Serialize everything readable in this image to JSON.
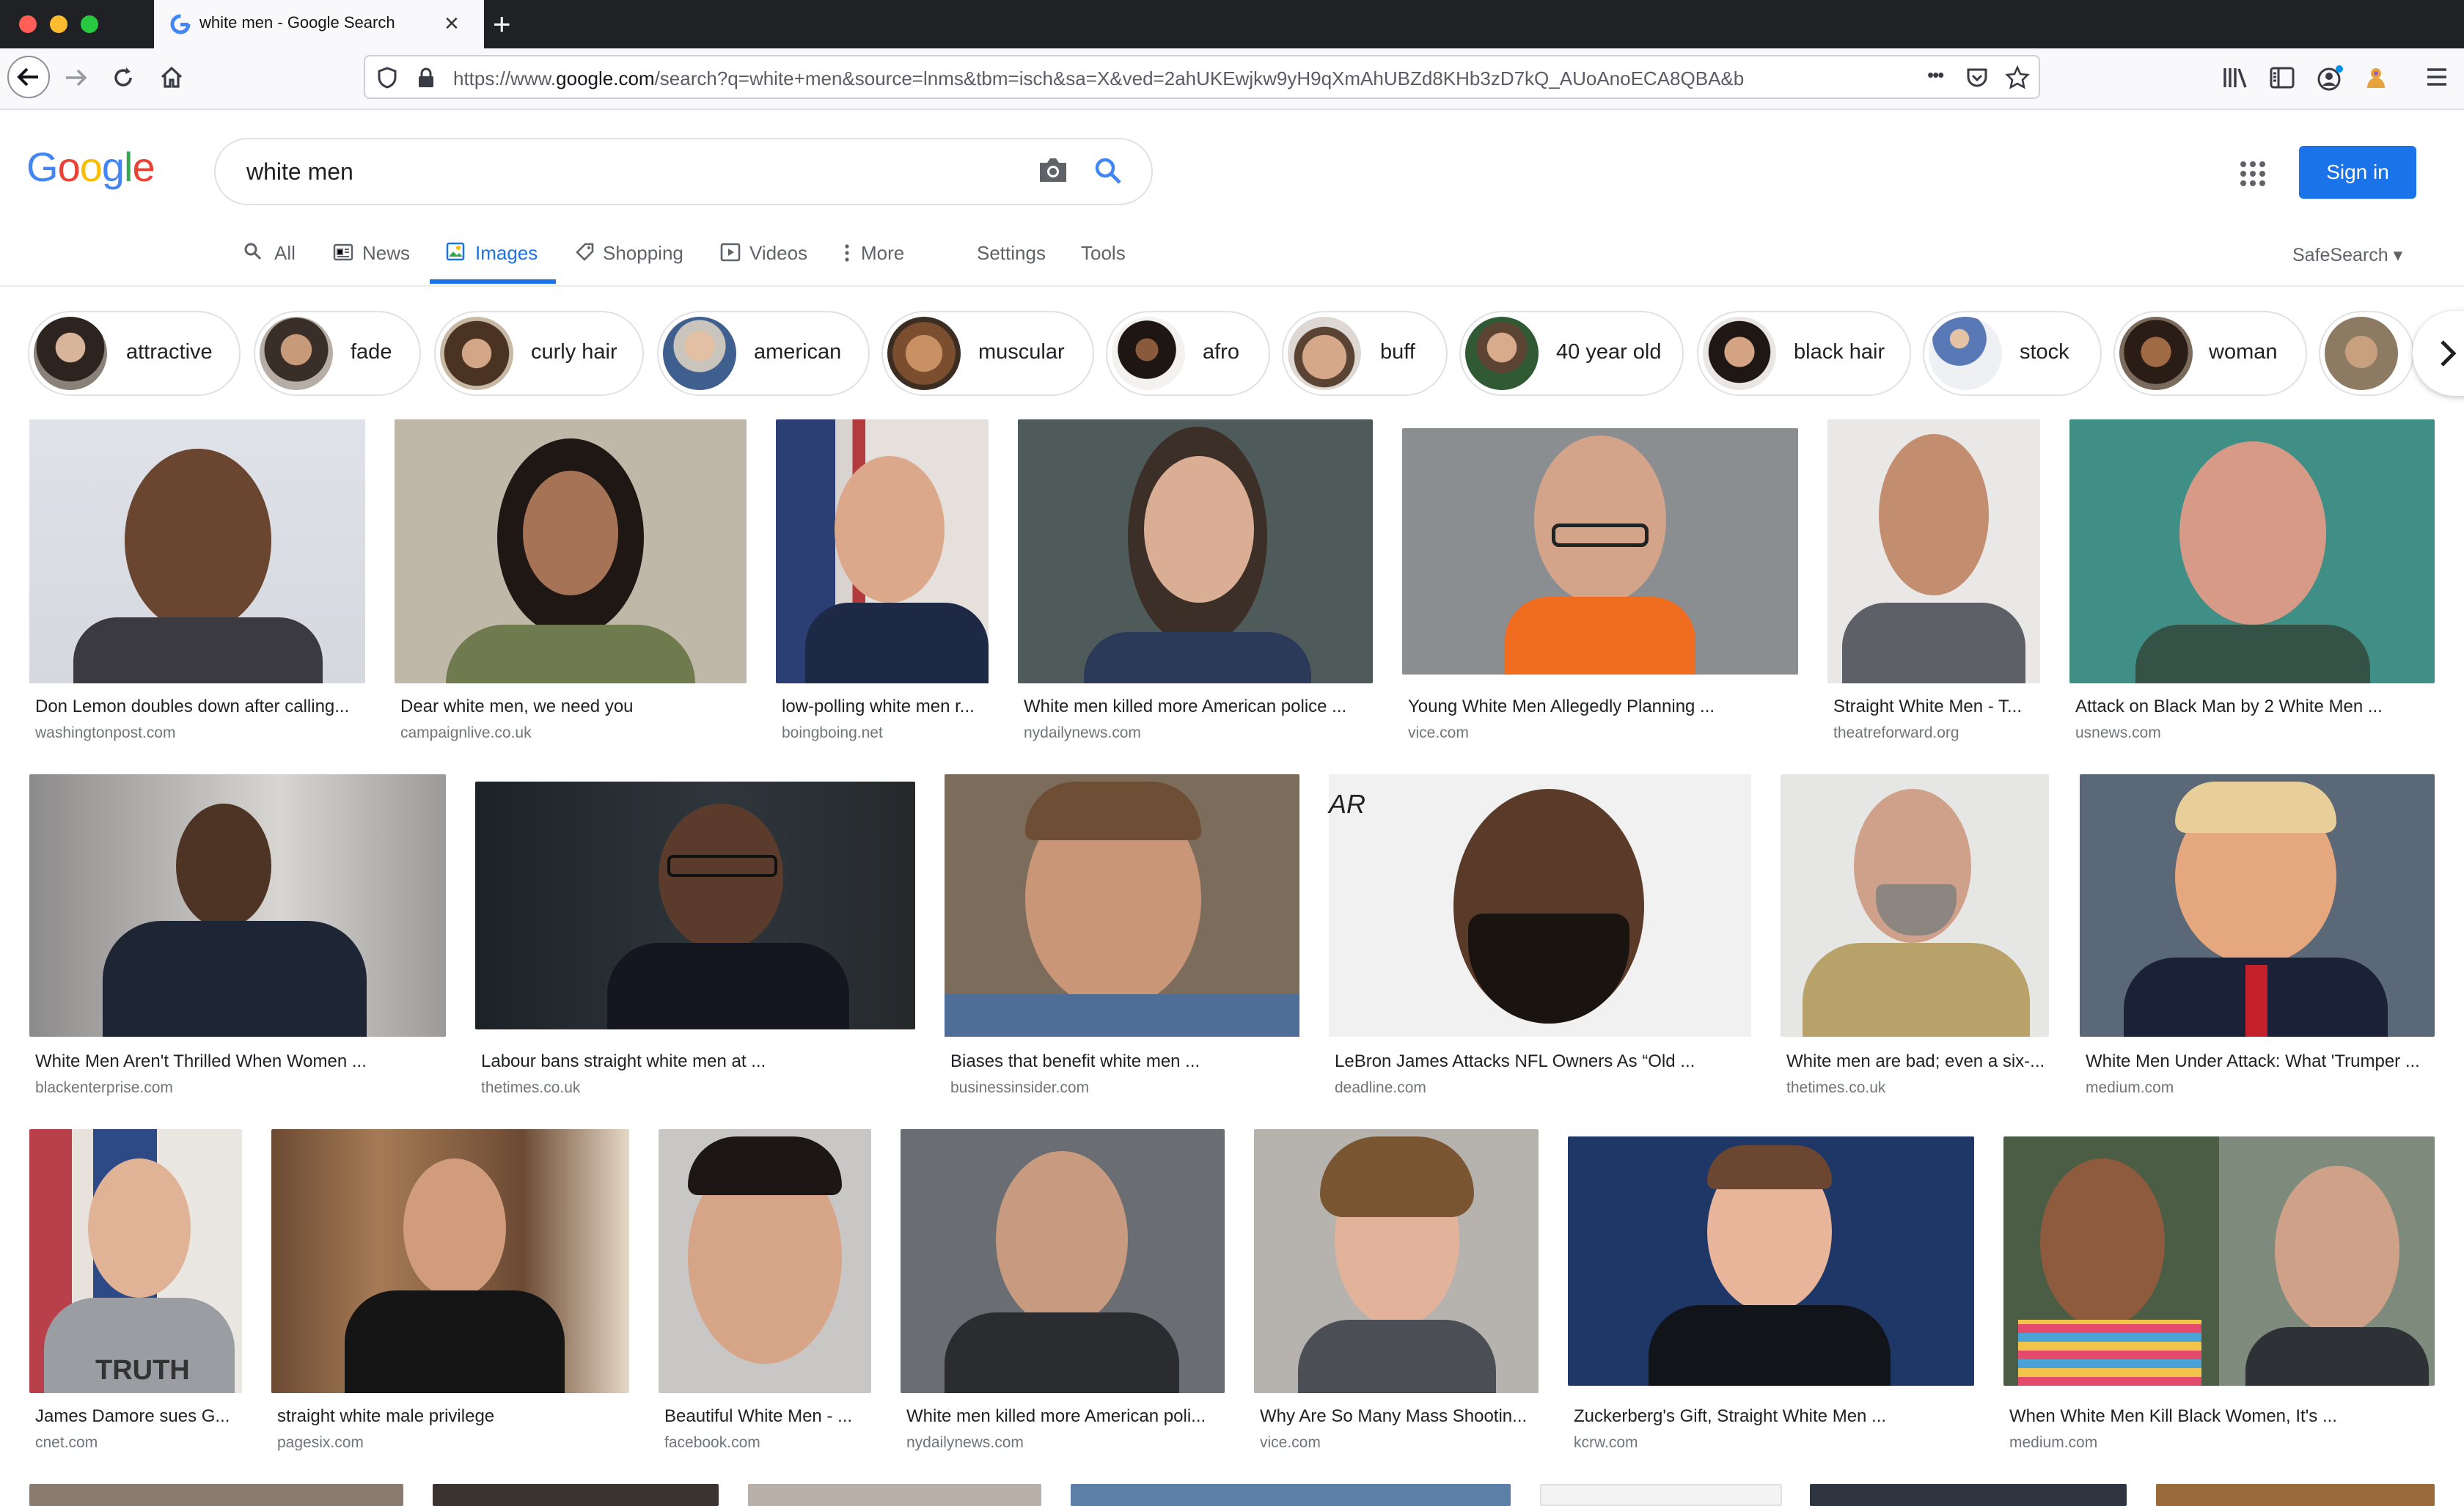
{
  "browser": {
    "tab_title": "white men - Google Search",
    "url_prefix": "https://www.",
    "url_domain": "google.com",
    "url_rest": "/search?q=white+men&source=lnms&tbm=isch&sa=X&ved=2ahUKEwjkw9yH9qXmAhUBZd8KHb3zD7kQ_AUoAnoECA8QBA&b",
    "dots": "•••"
  },
  "google": {
    "logo": [
      "G",
      "o",
      "o",
      "g",
      "l",
      "e"
    ],
    "query": "white men",
    "sign_in": "Sign in",
    "safesearch": "SafeSearch",
    "nav": [
      "All",
      "News",
      "Images",
      "Shopping",
      "Videos",
      "More",
      "Settings",
      "Tools"
    ]
  },
  "chips": [
    "attractive",
    "fade",
    "curly hair",
    "american",
    "muscular",
    "afro",
    "buff",
    "40 year old",
    "black hair",
    "stock",
    "woman"
  ],
  "results": [
    {
      "caption": "Don Lemon doubles down after calling...",
      "source": "washingtonpost.com"
    },
    {
      "caption": "Dear white men, we need you",
      "source": "campaignlive.co.uk"
    },
    {
      "caption": "low-polling white men r...",
      "source": "boingboing.net"
    },
    {
      "caption": "White men killed more American police ...",
      "source": "nydailynews.com"
    },
    {
      "caption": "Young White Men Allegedly Planning ...",
      "source": "vice.com"
    },
    {
      "caption": "Straight White Men - T...",
      "source": "theatreforward.org"
    },
    {
      "caption": "Attack on Black Man by 2 White Men ...",
      "source": "usnews.com"
    },
    {
      "caption": "White Men Aren't Thrilled When Women ...",
      "source": "blackenterprise.com"
    },
    {
      "caption": "Labour bans straight white men at ...",
      "source": "thetimes.co.uk"
    },
    {
      "caption": "Biases that benefit white men ...",
      "source": "businessinsider.com"
    },
    {
      "caption": "LeBron James Attacks NFL Owners As “Old ...",
      "source": "deadline.com"
    },
    {
      "caption": "White men are bad; even a six-...",
      "source": "thetimes.co.uk"
    },
    {
      "caption": "White Men Under Attack: What 'Trumper ...",
      "source": "medium.com"
    },
    {
      "caption": "James Damore sues G...",
      "source": "cnet.com"
    },
    {
      "caption": "straight white male privilege",
      "source": "pagesix.com"
    },
    {
      "caption": "Beautiful White Men - ...",
      "source": "facebook.com"
    },
    {
      "caption": "White men killed more American poli...",
      "source": "nydailynews.com"
    },
    {
      "caption": "Why Are So Many Mass Shootin...",
      "source": "vice.com"
    },
    {
      "caption": "Zuckerberg's Gift, Straight White Men ...",
      "source": "kcrw.com"
    },
    {
      "caption": "When White Men Kill Black Women, It's ...",
      "source": "medium.com"
    }
  ],
  "image_text": {
    "shirt": "TRUTH",
    "ar": "AR"
  },
  "colors": {
    "accent": "#1a73e8",
    "tabbar": "#202124",
    "caption": "#202124",
    "source": "#70757a"
  }
}
